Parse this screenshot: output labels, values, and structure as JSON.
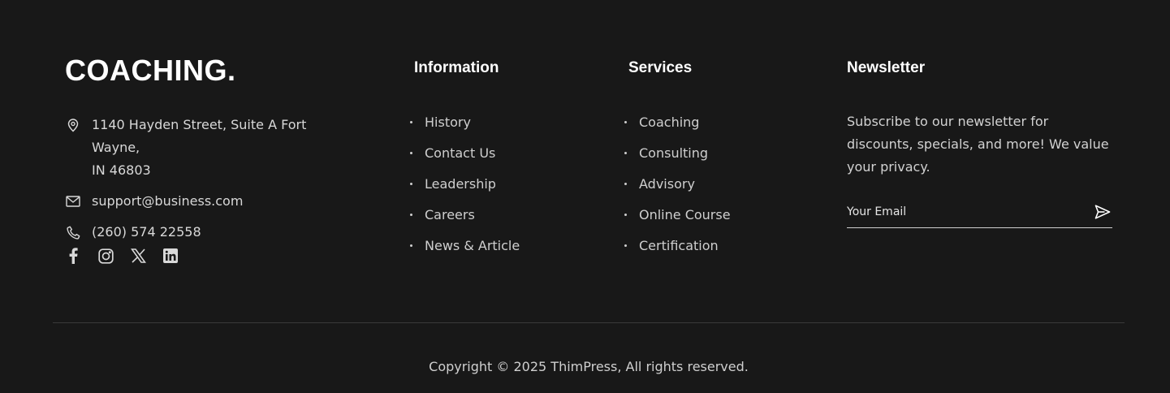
{
  "brand": {
    "logo_text": "COACHING."
  },
  "contact": {
    "address_line1": "1140 Hayden Street, Suite A Fort Wayne,",
    "address_line2": "IN 46803",
    "email": "support@business.com",
    "phone": "(260) 574 22558"
  },
  "socials": [
    {
      "icon": "facebook-icon"
    },
    {
      "icon": "instagram-icon"
    },
    {
      "icon": "x-icon"
    },
    {
      "icon": "linkedin-icon"
    }
  ],
  "information": {
    "title": "Information",
    "links": [
      "History",
      "Contact Us",
      "Leadership",
      "Careers",
      "News & Article"
    ]
  },
  "services": {
    "title": "Services",
    "links": [
      "Coaching",
      "Consulting",
      "Advisory",
      "Online Course",
      "Certification"
    ]
  },
  "newsletter": {
    "title": "Newsletter",
    "description": "Subscribe to our newsletter for discounts, specials, and more! We value your privacy.",
    "email_placeholder": "Your Email",
    "email_value": ""
  },
  "copyright": "Copyright © 2025 ThimPress, All rights reserved.",
  "colors": {
    "background": "#181818",
    "heading": "#ffffff",
    "text": "#cfcfcf",
    "divider": "#3a3a3a"
  }
}
